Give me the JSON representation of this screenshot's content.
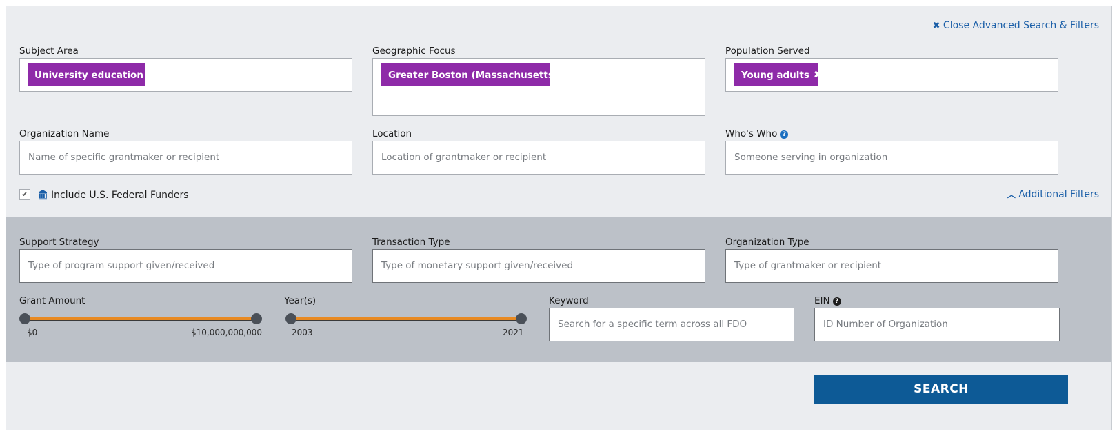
{
  "header": {
    "close_label": "Close Advanced Search & Filters",
    "close_icon": "close-icon"
  },
  "subject_area": {
    "label": "Subject Area",
    "tags": [
      "University education"
    ]
  },
  "geographic_focus": {
    "label": "Geographic Focus",
    "tags": [
      "Greater Boston (Massachusetts)"
    ]
  },
  "population_served": {
    "label": "Population Served",
    "tags": [
      "Young adults"
    ]
  },
  "organization_name": {
    "label": "Organization Name",
    "placeholder": "Name of specific grantmaker or recipient"
  },
  "location": {
    "label": "Location",
    "placeholder": "Location of grantmaker or recipient"
  },
  "whos_who": {
    "label": "Who's Who",
    "placeholder": "Someone serving in organization"
  },
  "federal_funders": {
    "label": "Include U.S. Federal Funders",
    "checked": true,
    "icon": "bank-icon"
  },
  "additional_filters": {
    "label": "Additional Filters",
    "icon": "chevron-up-icon"
  },
  "support_strategy": {
    "label": "Support Strategy",
    "placeholder": "Type of program support given/received"
  },
  "transaction_type": {
    "label": "Transaction Type",
    "placeholder": "Type of monetary support given/received"
  },
  "organization_type": {
    "label": "Organization Type",
    "placeholder": "Type of grantmaker or recipient"
  },
  "grant_amount": {
    "label": "Grant Amount",
    "min_label": "$0",
    "max_label": "$10,000,000,000"
  },
  "years": {
    "label": "Year(s)",
    "min_label": "2003",
    "max_label": "2021"
  },
  "keyword": {
    "label": "Keyword",
    "placeholder": "Search for a specific term across all FDO"
  },
  "ein": {
    "label": "EIN",
    "placeholder": "ID Number of Organization"
  },
  "search_button": {
    "label": "SEARCH"
  },
  "colors": {
    "tag_bg": "#8e2aa8",
    "link": "#1b5fa8",
    "slider_track": "#e88a22",
    "slider_knob": "#4a5058",
    "search_button": "#0d5a96",
    "panel_bg": "#ebedf0",
    "filters_bg": "#bcc1c8"
  }
}
